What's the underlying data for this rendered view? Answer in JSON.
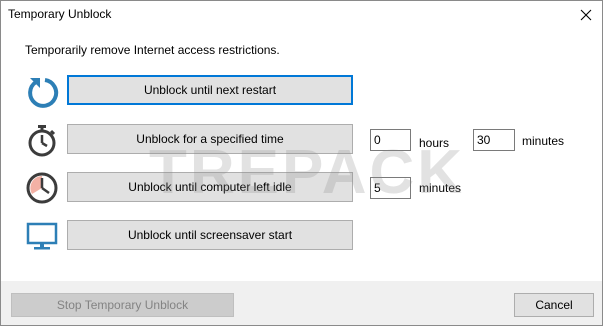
{
  "window": {
    "title": "Temporary Unblock"
  },
  "description": "Temporarily remove Internet access restrictions.",
  "options": [
    {
      "label": "Unblock until next restart",
      "icon": "restart-arrow-icon"
    },
    {
      "label": "Unblock for a specified time",
      "icon": "stopwatch-icon"
    },
    {
      "label": "Unblock until computer left idle",
      "icon": "clock-icon"
    },
    {
      "label": "Unblock until screensaver start",
      "icon": "monitor-icon"
    }
  ],
  "specified_time": {
    "hours_value": "0",
    "hours_label": "hours",
    "minutes_value": "30",
    "minutes_label": "minutes"
  },
  "idle": {
    "minutes_value": "5",
    "minutes_label": "minutes"
  },
  "watermark": "TREPACK",
  "footer": {
    "stop_label": "Stop Temporary Unblock",
    "cancel_label": "Cancel"
  },
  "colors": {
    "accent": "#0078d7",
    "icon_blue": "#2d7fb6",
    "icon_dark": "#3c3c3c",
    "clock_fill": "#f3b1a5"
  }
}
